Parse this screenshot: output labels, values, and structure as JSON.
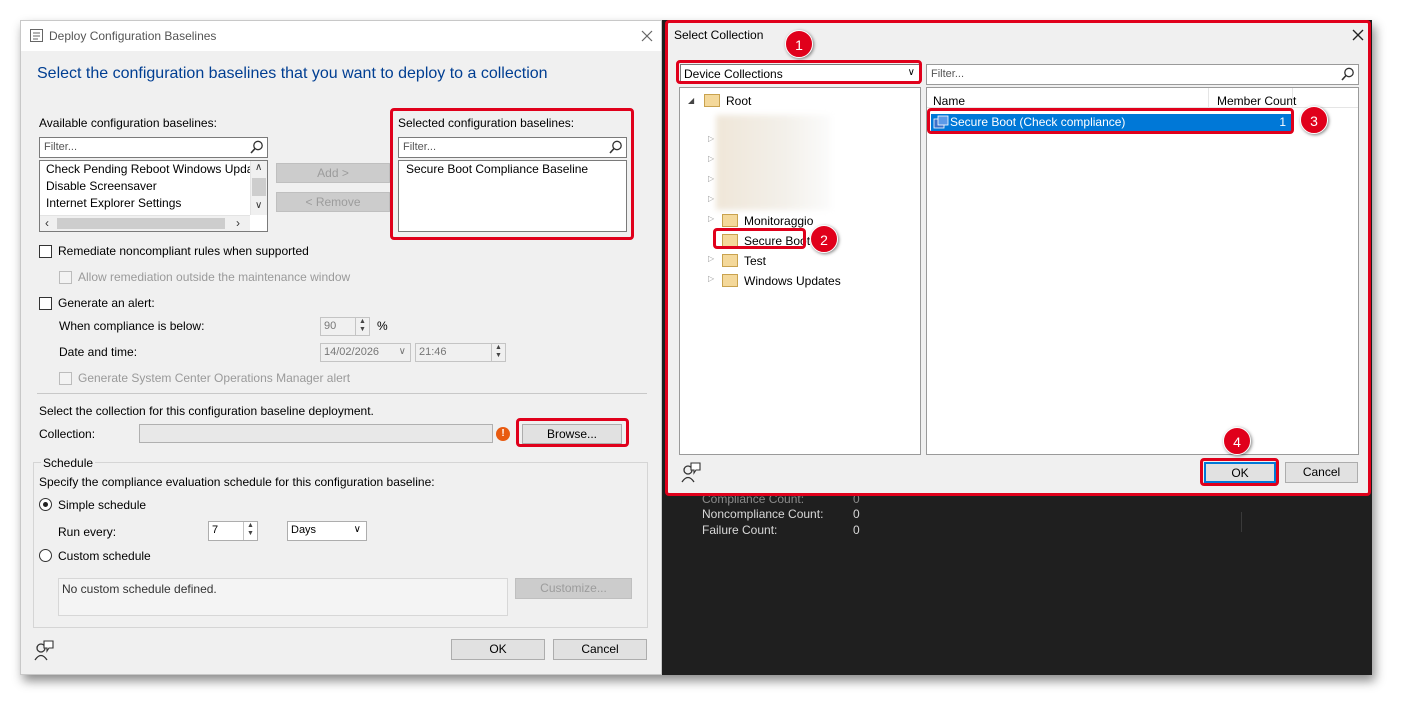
{
  "deploy": {
    "title": "Deploy Configuration Baselines",
    "heading": "Select the configuration baselines that you want to deploy to a collection",
    "available_label": "Available configuration baselines:",
    "available_filter_placeholder": "Filter...",
    "available_items": [
      "Check Pending Reboot Windows Update",
      "Disable Screensaver",
      "Internet Explorer Settings"
    ],
    "add_button": "Add >",
    "remove_button": "< Remove",
    "selected_label": "Selected configuration baselines:",
    "selected_filter_placeholder": "Filter...",
    "selected_items": [
      "Secure Boot Compliance Baseline"
    ],
    "remediate_label": "Remediate noncompliant rules when supported",
    "allow_remediation_label": "Allow remediation outside the maintenance window",
    "generate_alert_label": "Generate an alert:",
    "compliance_below_label": "When compliance is below:",
    "compliance_value": "90",
    "percent": "%",
    "date_time_label": "Date and time:",
    "date_value": "14/02/2026",
    "time_value": "21:46",
    "scom_alert_label": "Generate System Center Operations Manager alert",
    "collection_prompt": "Select the collection for this configuration baseline deployment.",
    "collection_label": "Collection:",
    "collection_value": "",
    "browse_button": "Browse...",
    "schedule_group": "Schedule",
    "schedule_prompt": "Specify the compliance evaluation schedule for this configuration baseline:",
    "simple_schedule": "Simple schedule",
    "run_every_label": "Run every:",
    "run_every_value": "7",
    "run_every_unit": "Days",
    "custom_schedule": "Custom schedule",
    "custom_schedule_text": "No custom schedule defined.",
    "customize_button": "Customize...",
    "ok_button": "OK",
    "cancel_button": "Cancel"
  },
  "select_collection": {
    "title": "Select Collection",
    "collection_type": "Device Collections",
    "filter_placeholder": "Filter...",
    "tree": {
      "root": "Root",
      "folders": [
        "Monitoraggio",
        "Secure Boot",
        "Test",
        "Windows Updates"
      ]
    },
    "columns": [
      "Name",
      "Member Count"
    ],
    "rows": [
      {
        "name": "Secure Boot (Check compliance)",
        "count": "1"
      }
    ],
    "ok_button": "OK",
    "cancel_button": "Cancel"
  },
  "background_panel": {
    "rows": [
      {
        "label": "Compliance Count:",
        "value": "0"
      },
      {
        "label": "Noncompliance Count:",
        "value": "0"
      },
      {
        "label": "Failure Count:",
        "value": "0"
      }
    ]
  },
  "callouts": [
    "1",
    "2",
    "3",
    "4"
  ],
  "colors": {
    "highlight_red": "#e0001b",
    "heading_blue": "#003e92",
    "selection_blue": "#0078d7",
    "dark_background": "#1f1f1f"
  }
}
